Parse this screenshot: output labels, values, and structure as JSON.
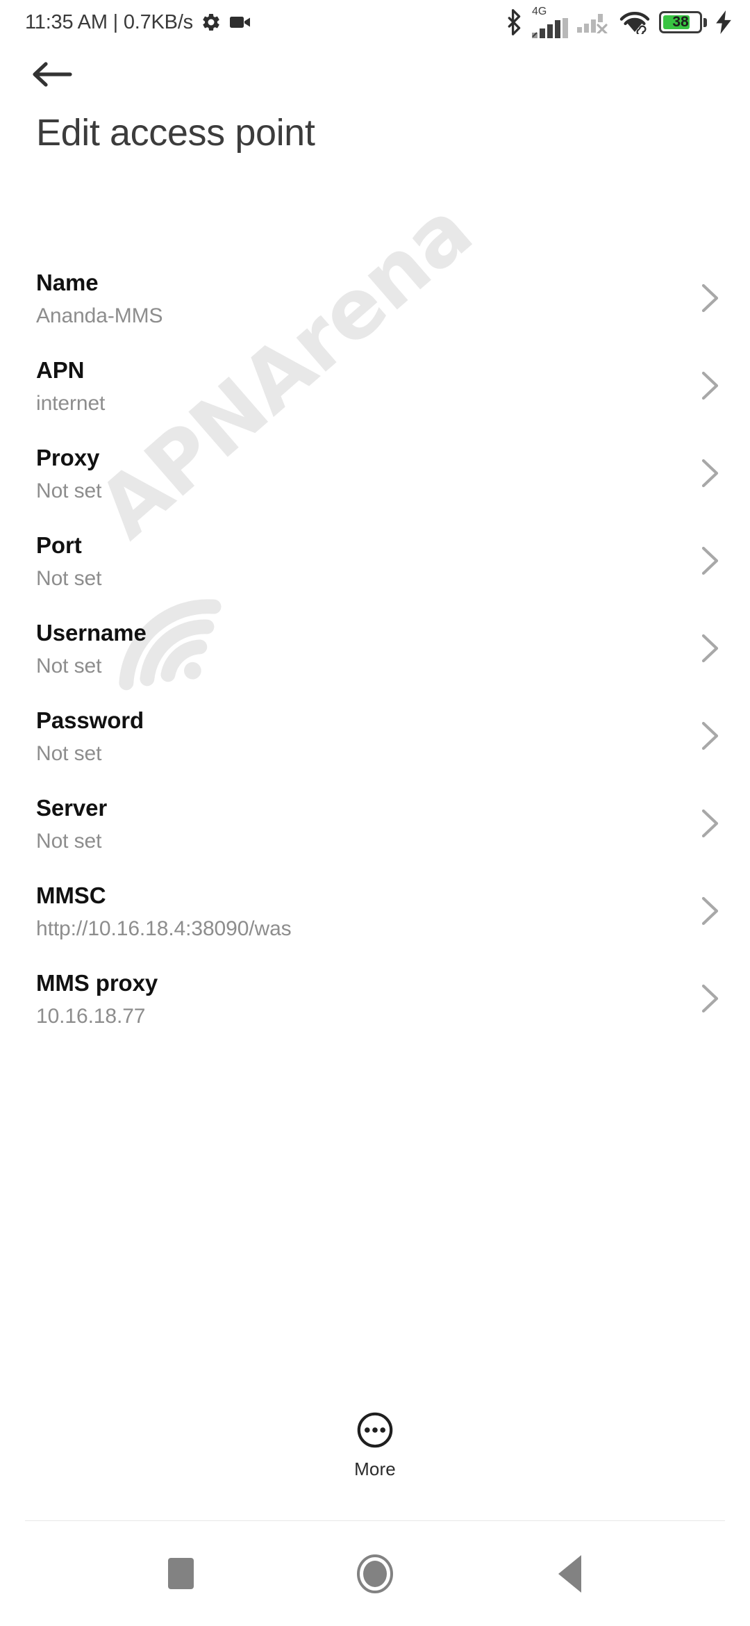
{
  "status_bar": {
    "clock_and_rate": "11:35 AM | 0.7KB/s",
    "settings_icon": "gear-icon",
    "recorder_icon": "video-camera-icon",
    "bluetooth_icon": "bluetooth-icon",
    "network_type": "4G",
    "sim1_signal_icon": "signal-bars-icon",
    "sim2_signal_icon": "signal-bars-no-service-icon",
    "wifi_icon": "wifi-icon",
    "battery_level": "38",
    "battery_icon": "battery-icon",
    "charging_icon": "charging-bolt-icon",
    "colors": {
      "battery_fill": "#38c442",
      "icon": "#4a4a4a",
      "text": "#3a3a3a"
    }
  },
  "header": {
    "back_label": "back-arrow",
    "title": "Edit access point"
  },
  "watermark": {
    "text": "APNArena",
    "logo": "wifi-arcs-icon",
    "color": "#e8e8e8"
  },
  "settings": {
    "rows": [
      {
        "label": "Name",
        "value": "Ananda-MMS"
      },
      {
        "label": "APN",
        "value": "internet"
      },
      {
        "label": "Proxy",
        "value": "Not set"
      },
      {
        "label": "Port",
        "value": "Not set"
      },
      {
        "label": "Username",
        "value": "Not set"
      },
      {
        "label": "Password",
        "value": "Not set"
      },
      {
        "label": "Server",
        "value": "Not set"
      },
      {
        "label": "MMSC",
        "value": "http://10.16.18.4:38090/was"
      },
      {
        "label": "MMS proxy",
        "value": "10.16.18.77"
      }
    ],
    "chevron_icon": "chevron-right-icon"
  },
  "more_button": {
    "label": "More",
    "icon": "more-ellipsis-circle-icon"
  },
  "navigation_bar": {
    "recents_label": "recents-square",
    "home_label": "home-circle",
    "back_label": "back-triangle",
    "color": "#828282"
  }
}
